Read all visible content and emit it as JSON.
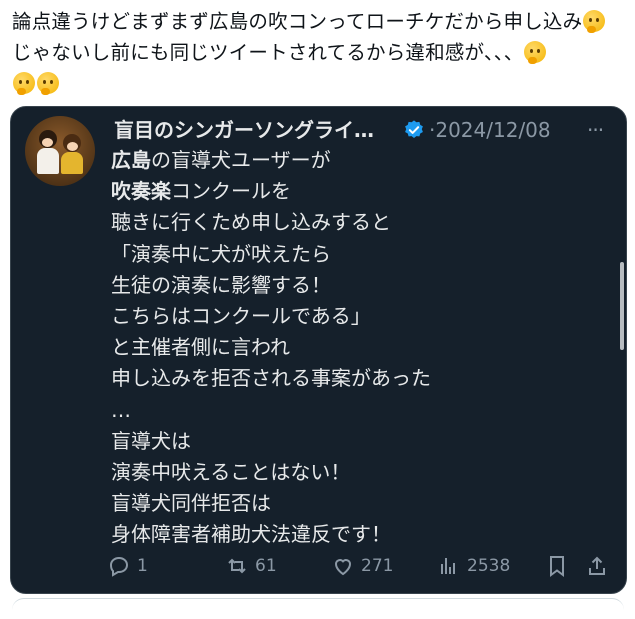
{
  "post": {
    "text_line1": "論点違うけどまずまず広島の吹コンってローチケだから申し込み",
    "text_line2": "じゃないし前にも同じツイートされてるから違和感が、、、",
    "emoji_name": "thinking-face"
  },
  "quoted": {
    "author_name": "盲目のシンガーソングライ…",
    "date": "2024/12/08",
    "dot": "·",
    "more": "···",
    "lines": [
      {
        "bold": "広島",
        "rest": "の盲導犬ユーザーが"
      },
      {
        "bold": "吹奏楽",
        "rest": "コンクールを"
      },
      {
        "bold": "",
        "rest": "聴きに行くため申し込みすると"
      },
      {
        "bold": "",
        "rest": "「演奏中に犬が吠えたら"
      },
      {
        "bold": "",
        "rest": "生徒の演奏に影響する！"
      },
      {
        "bold": "",
        "rest": "こちらはコンクールである」"
      },
      {
        "bold": "",
        "rest": "と主催者側に言われ"
      },
      {
        "bold": "",
        "rest": "申し込みを拒否される事案があった"
      },
      {
        "bold": "",
        "rest": "…"
      },
      {
        "bold": "",
        "rest": "盲導犬は"
      },
      {
        "bold": "",
        "rest": "演奏中吠えることはない！"
      },
      {
        "bold": "",
        "rest": "盲導犬同伴拒否は"
      },
      {
        "bold": "",
        "rest": "身体障害者補助犬法違反です！"
      }
    ],
    "actions": {
      "replies": "1",
      "reposts": "61",
      "likes": "271",
      "views": "2538"
    }
  },
  "colors": {
    "card_bg": "#15202b",
    "text_primary": "#e7e9ea",
    "text_secondary": "#8b98a5",
    "verified_blue": "#1d9bf0"
  }
}
